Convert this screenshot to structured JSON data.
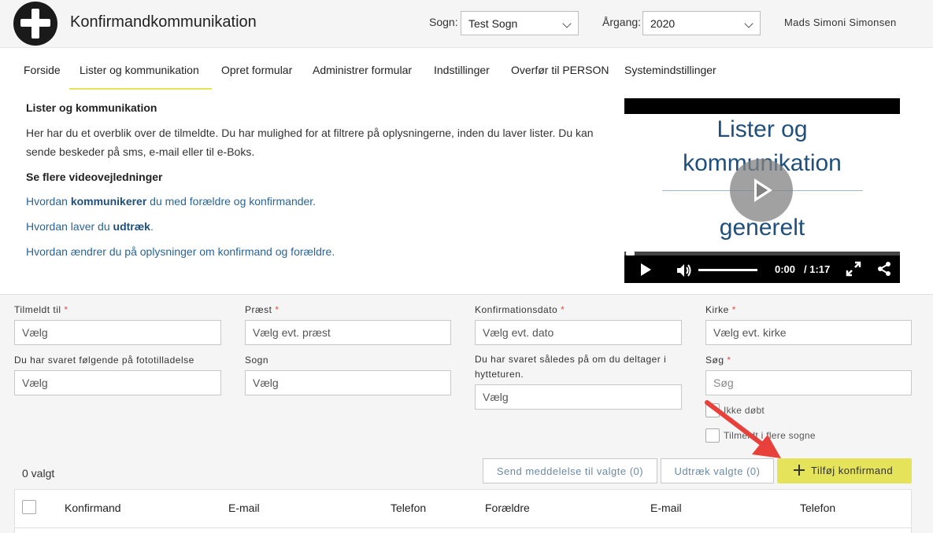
{
  "app": {
    "title": "Konfirmandkommunikation"
  },
  "header": {
    "parish_label": "Sogn:",
    "parish_value": "Test Sogn",
    "year_label": "Årgang:",
    "year_value": "2020",
    "user_name": "Mads Simoni Simonsen"
  },
  "nav": {
    "items": [
      "Forside",
      "Lister og kommunikation",
      "Opret formular",
      "Administrer formular",
      "Indstillinger",
      "Overfør til PERSON",
      "Systemindstillinger"
    ],
    "active_index": 1
  },
  "intro": {
    "title": "Lister og kommunikation",
    "text": "Her har du et overblik over de tilmeldte. Du har mulighed for at filtrere på oplysningerne, inden du laver lister. Du kan sende beskeder på sms, e-mail eller til e-Boks.",
    "videos_heading": "Se flere videovejledninger",
    "link1_pre": "Hvordan ",
    "link1_bold": "kommunikerer",
    "link1_post": " du med forældre og konfirmander.",
    "link2_pre": "Hvordan laver du ",
    "link2_bold": "udtræk",
    "link2_post": ".",
    "link3": "Hvordan ændrer du på oplysninger om konfirmand og forældre."
  },
  "video": {
    "title_line1": "Lister og",
    "title_line2": "kommunikation",
    "title_line3": "generelt",
    "current_time": "0:00",
    "duration": "/ 1:17",
    "progress": 0
  },
  "filters": {
    "registered_to": {
      "label": "Tilmeldt til",
      "required": "*",
      "placeholder": "Vælg"
    },
    "priest": {
      "label": "Præst",
      "required": "*",
      "placeholder": "Vælg evt. præst"
    },
    "confirmation_date": {
      "label": "Konfirmationsdato",
      "required": "*",
      "placeholder": "Vælg evt. dato"
    },
    "church": {
      "label": "Kirke",
      "required": "*",
      "placeholder": "Vælg evt. kirke"
    },
    "photo_permission": {
      "label": "Du har svaret følgende på fototilladelse",
      "placeholder": "Vælg"
    },
    "parish": {
      "label": "Sogn",
      "placeholder": "Vælg"
    },
    "cabin_trip": {
      "label": "Du har svaret således på om du deltager i hytteturen.",
      "placeholder": "Vælg"
    },
    "search": {
      "label": "Søg",
      "required": "*",
      "placeholder": "Søg"
    },
    "not_baptized_label": "Ikke døbt",
    "multiple_parishes_label": "Tilmeldt i flere sogne"
  },
  "actions": {
    "selected_count": "0 valgt",
    "send_message": "Send meddelelse til valgte (0)",
    "extract_selected": "Udtræk valgte (0)",
    "add_confirmand": "Tilføj konfirmand"
  },
  "table": {
    "columns": [
      "Konfirmand",
      "E-mail",
      "Telefon",
      "Forældre",
      "E-mail",
      "Telefon"
    ]
  },
  "colors": {
    "accent": "#e4e35a",
    "link": "#2a6496",
    "required": "#d9534f",
    "annotation_arrow": "#e8413c"
  }
}
